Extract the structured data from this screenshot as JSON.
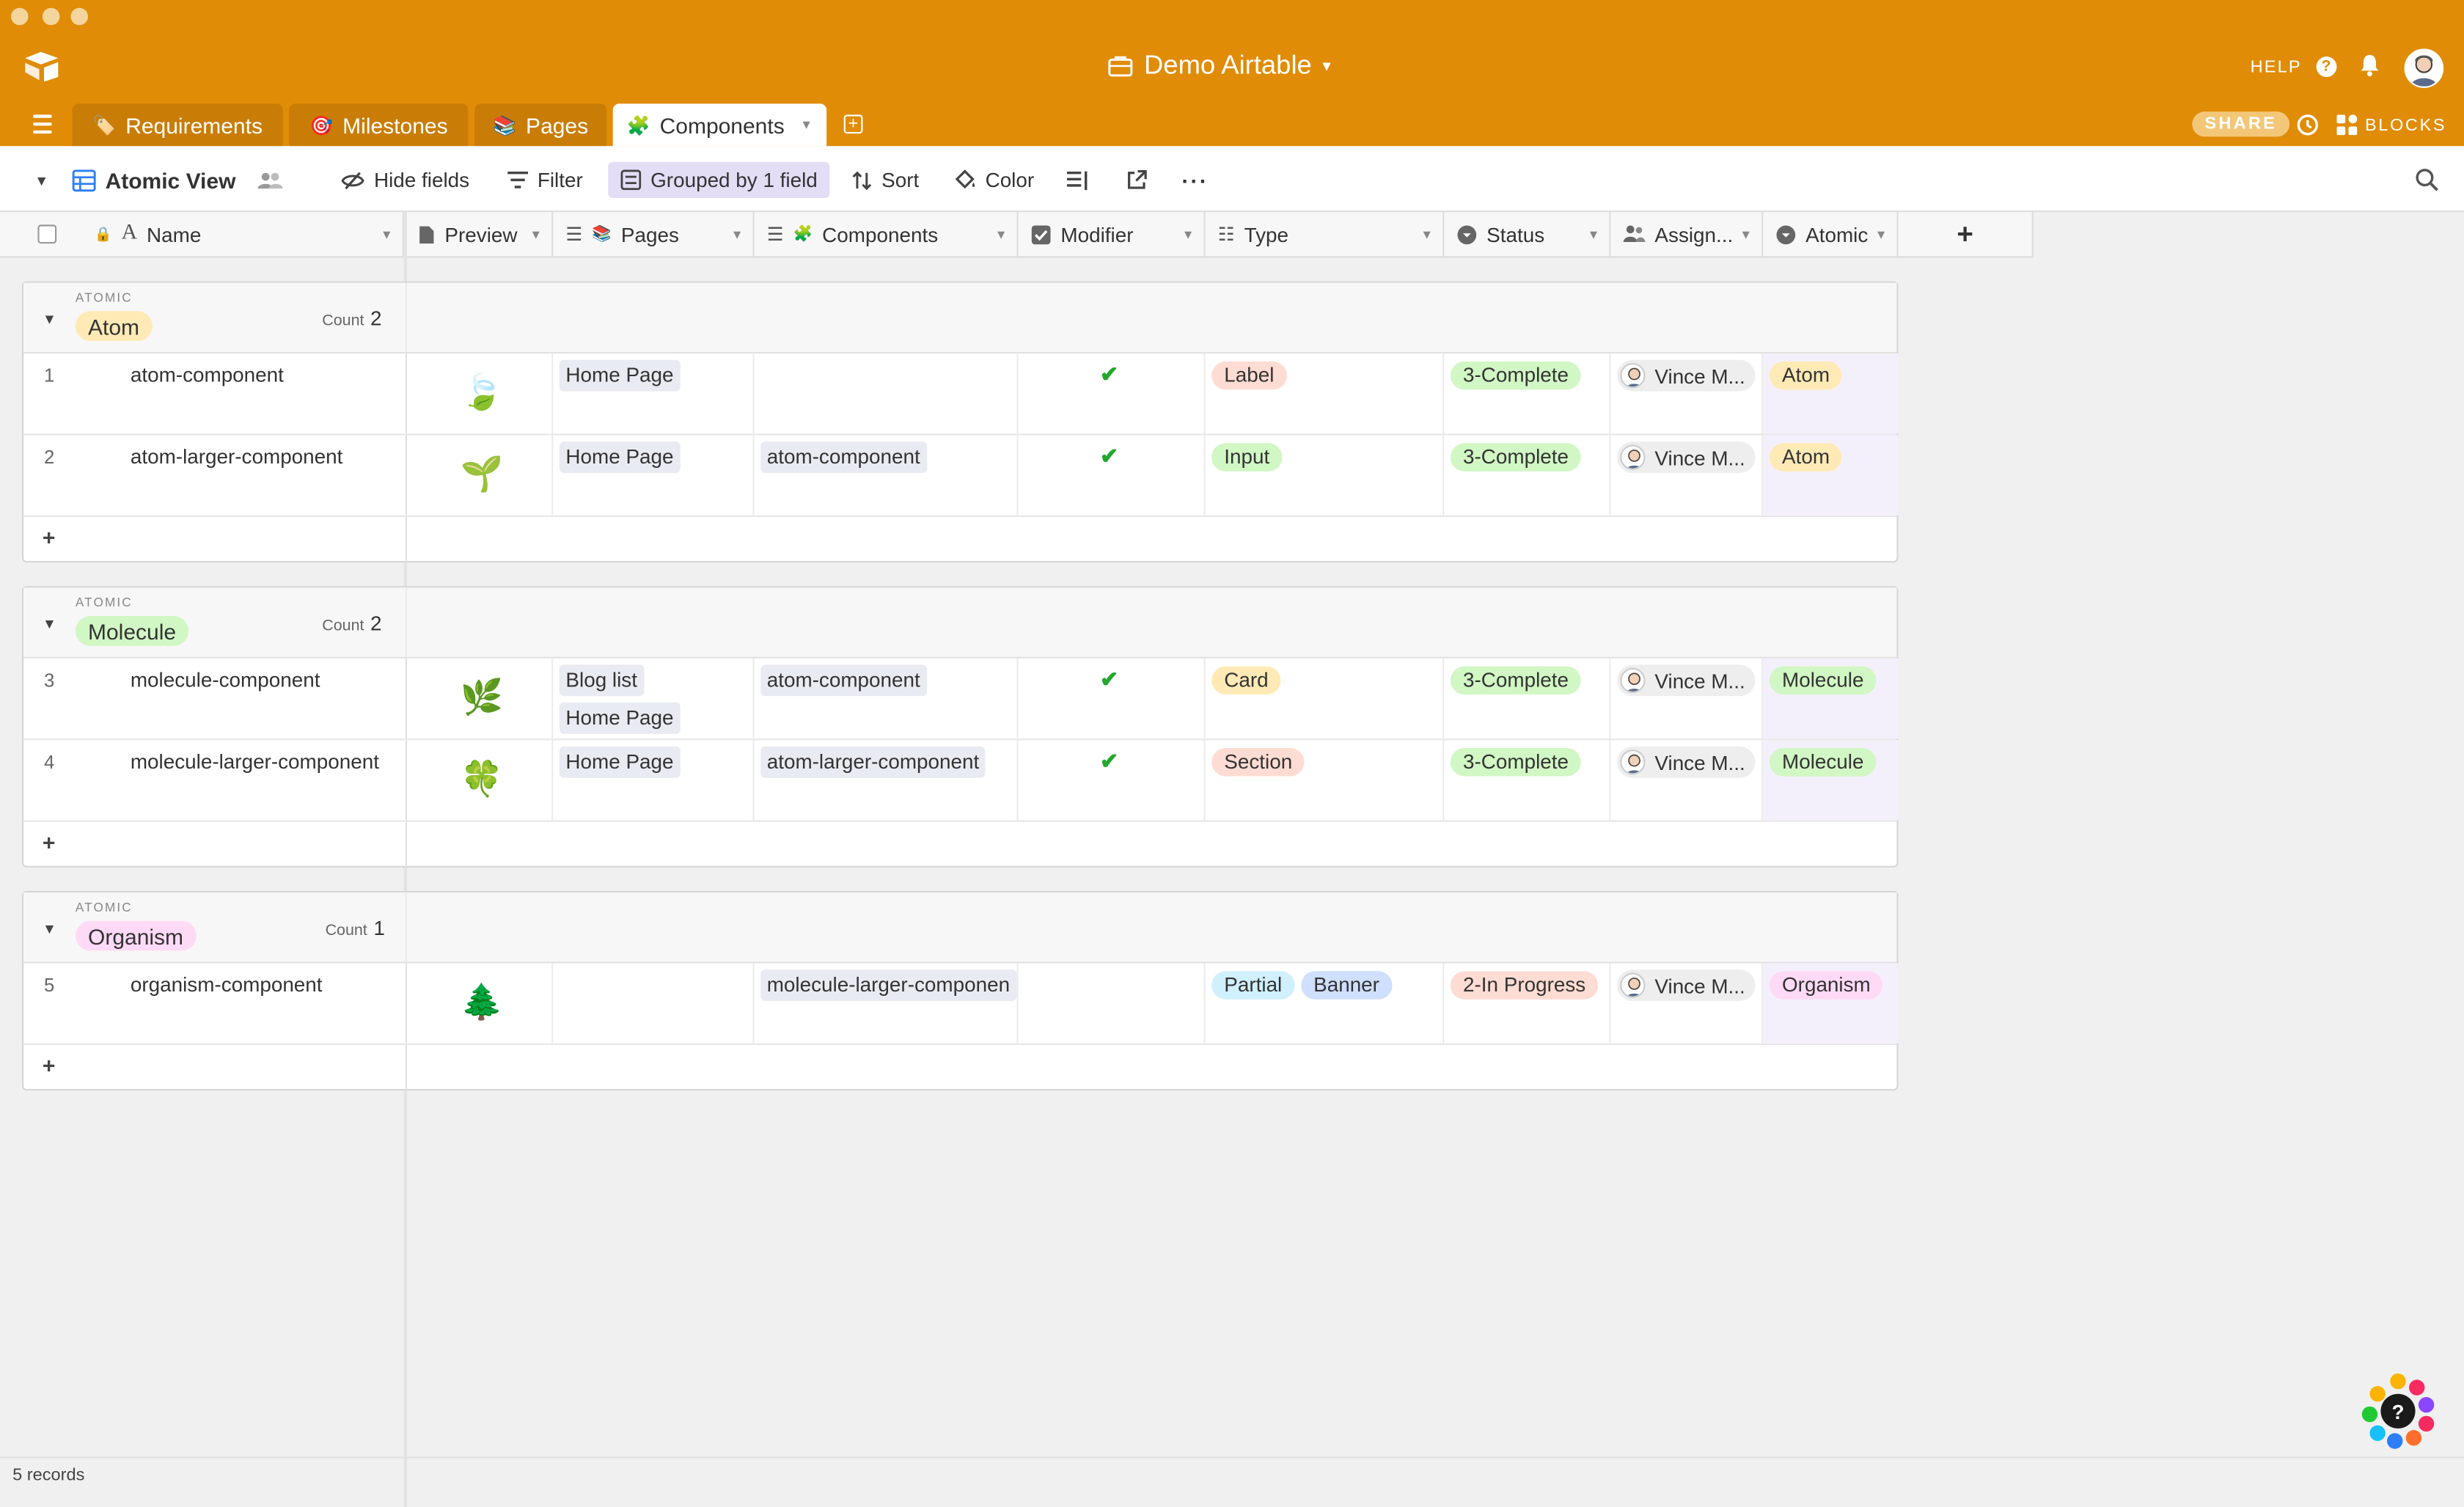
{
  "header": {
    "base_name": "Demo Airtable",
    "help": "HELP",
    "share": "SHARE",
    "blocks": "BLOCKS",
    "accent": "#e08c07"
  },
  "tabs": [
    {
      "emoji": "🏷️",
      "label": "Requirements"
    },
    {
      "emoji": "🎯",
      "label": "Milestones"
    },
    {
      "emoji": "📚",
      "label": "Pages"
    },
    {
      "emoji": "🧩",
      "label": "Components"
    }
  ],
  "toolbar": {
    "view_name": "Atomic View",
    "hide_fields": "Hide fields",
    "filter": "Filter",
    "grouped": "Grouped by 1 field",
    "sort": "Sort",
    "color": "Color"
  },
  "columns": {
    "name": "Name",
    "preview": "Preview",
    "pages": "Pages",
    "components": "Components",
    "modifier": "Modifier",
    "type": "Type",
    "status": "Status",
    "assignee": "Assign...",
    "atomic": "Atomic"
  },
  "groups": [
    {
      "field": "ATOMIC",
      "value": "Atom",
      "count_label": "Count",
      "count": "2",
      "color": "#ffeab6",
      "rows": [
        {
          "num": "1",
          "name": "atom-component",
          "preview": "🍃",
          "pages": [
            "Home Page"
          ],
          "components": [],
          "modifier": "✔",
          "type": [
            {
              "label": "Label",
              "color": "#ffdcd3"
            }
          ],
          "status": "3-Complete",
          "assignee": "Vince M...",
          "atomic": "Atom"
        },
        {
          "num": "2",
          "name": "atom-larger-component",
          "preview": "🌱",
          "pages": [
            "Home Page"
          ],
          "components": [
            "atom-component"
          ],
          "modifier": "✔",
          "type": [
            {
              "label": "Input",
              "color": "#d1f7c4"
            }
          ],
          "status": "3-Complete",
          "assignee": "Vince M...",
          "atomic": "Atom"
        }
      ]
    },
    {
      "field": "ATOMIC",
      "value": "Molecule",
      "count_label": "Count",
      "count": "2",
      "color": "#d1f7c4",
      "rows": [
        {
          "num": "3",
          "name": "molecule-component",
          "preview": "🌿",
          "pages": [
            "Blog list",
            "Home Page"
          ],
          "components": [
            "atom-component"
          ],
          "modifier": "✔",
          "type": [
            {
              "label": "Card",
              "color": "#ffeab6"
            }
          ],
          "status": "3-Complete",
          "assignee": "Vince M...",
          "atomic": "Molecule"
        },
        {
          "num": "4",
          "name": "molecule-larger-component",
          "preview": "🍀",
          "pages": [
            "Home Page"
          ],
          "components": [
            "atom-larger-component"
          ],
          "modifier": "✔",
          "type": [
            {
              "label": "Section",
              "color": "#ffdcd3"
            }
          ],
          "status": "3-Complete",
          "assignee": "Vince M...",
          "atomic": "Molecule"
        }
      ]
    },
    {
      "field": "ATOMIC",
      "value": "Organism",
      "count_label": "Count",
      "count": "1",
      "color": "#ffdaf6",
      "rows": [
        {
          "num": "5",
          "name": "organism-component",
          "preview": "🌲",
          "pages": [],
          "components": [
            "molecule-larger-componen"
          ],
          "modifier": "",
          "type": [
            {
              "label": "Partial",
              "color": "#d0f0fd"
            },
            {
              "label": "Banner",
              "color": "#cfdfff"
            }
          ],
          "status": "2-In Progress",
          "assignee": "Vince M...",
          "atomic": "Organism"
        }
      ]
    }
  ],
  "status_colors": {
    "3-Complete": "#d1f7c4",
    "2-In Progress": "#ffdcd3"
  },
  "footer": {
    "records": "5 records"
  }
}
